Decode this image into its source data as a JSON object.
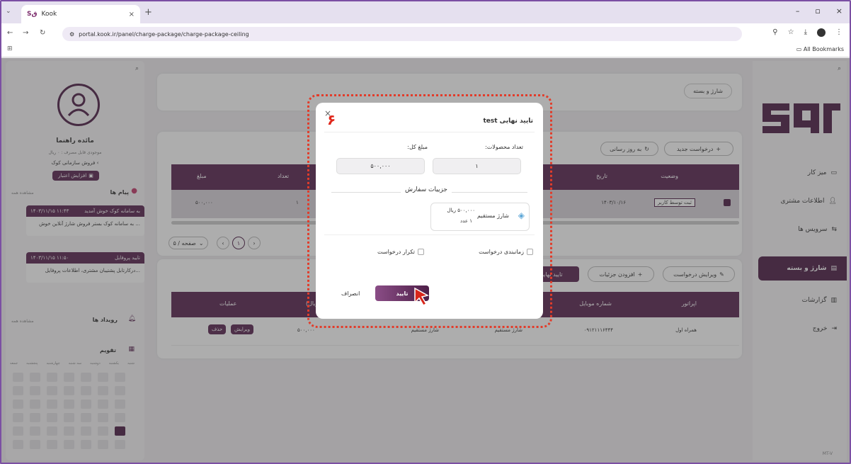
{
  "browser": {
    "tab_title": "Kook",
    "tab_favicon": "Sق",
    "url": "portal.kook.ir/panel/charge-package/charge-package-ceiling",
    "bookmarks_label": "All Bookmarks"
  },
  "header": {
    "breadcrumb": "شارژ و بسته"
  },
  "right_sidebar": {
    "logo": "Sqo",
    "items": [
      {
        "label": "میز کار",
        "icon": "monitor-icon"
      },
      {
        "label": "اطلاعات مشتری",
        "icon": "user-icon"
      },
      {
        "label": "سرویس ها",
        "icon": "services-icon"
      },
      {
        "label": "شارژ و بسته",
        "icon": "sim-icon",
        "active": true
      },
      {
        "label": "گزارشات",
        "icon": "chart-icon"
      },
      {
        "label": "خروج",
        "icon": "logout-icon"
      }
    ],
    "footer": "MT-V"
  },
  "left_sidebar": {
    "user_name": "مائده راهنما",
    "balance": "موجودی قابل مصرف : ۰ ریال",
    "store": "فروش سازمانی کوک",
    "credit_btn": "افزایش اعتبار",
    "messages_title": "پیام ها",
    "see_all": "مشاهده همه",
    "notes": [
      {
        "date": "۱۴۰۳/۱۱/۱۵ ۱۱:۴۳",
        "title": "به سامانه کوک خوش آمدید",
        "body": "به سامانه کوک بستر فروش شارژ آنلاین خوش ..."
      },
      {
        "date": "۱۴۰۳/۱۱/۱۵ ۱۱:۵۰",
        "title": "تایید پروفایل",
        "body": "درکارتابل پشتیبان مشتری، اطلاعات پروفایل..."
      }
    ],
    "events_title": "رویداد ها",
    "calendar_title": "تقویم",
    "weekdays": [
      "شنبه",
      "یکشنبه",
      "دوشنبه",
      "سه شنبه",
      "چهارشنبه",
      "پنجشنبه",
      "جمعه"
    ]
  },
  "toolbar1": {
    "new_request": "درخواست جدید",
    "refresh": "به روز رسانی"
  },
  "table1": {
    "headers": [
      "وضعیت",
      "تاریخ",
      "",
      "",
      "تعداد",
      "مبلغ"
    ],
    "row": {
      "status": "ثبت توسط کاربر",
      "date": "۱۴۰۳/۱۰/۱۶",
      "count": "۱",
      "amount": "۵۰۰,۰۰۰"
    }
  },
  "pagination": {
    "page": "۱",
    "per_page": "۵ / صفحه"
  },
  "toolbar2": {
    "edit": "ویرایش درخواست",
    "add_detail": "افزودن جزئیات",
    "confirm": "تایید نهایی"
  },
  "table2": {
    "headers": [
      "اپراتور",
      "شماره موبایل",
      "",
      "",
      "مبلغ (ریال)",
      "عملیات"
    ],
    "row": {
      "operator": "همراه اول",
      "mobile": "۰۹۱۲۱۱۱۶۴۴۴",
      "type1": "شارژ مستقیم",
      "type2": "شارژ مستقیم",
      "amount": "۵۰۰,۰۰۰",
      "edit": "ویرایش",
      "delete": "حذف"
    }
  },
  "modal": {
    "title": "تایید نهایی test",
    "count_label": "تعداد محصولات:",
    "count_value": "۱",
    "total_label": "مبلغ کل:",
    "total_value": "۵۰۰,۰۰۰",
    "section_title": "جزییات سفارش",
    "item_name": "شارژ مستقیم",
    "item_price": "۵۰۰,۰۰۰ ریال",
    "item_qty": "۱ عدد",
    "schedule_label": "زمانبندی درخواست",
    "repeat_label": "تکرار درخواست",
    "confirm_btn": "تایید",
    "cancel_btn": "انصراف",
    "step_badge": "۶"
  }
}
